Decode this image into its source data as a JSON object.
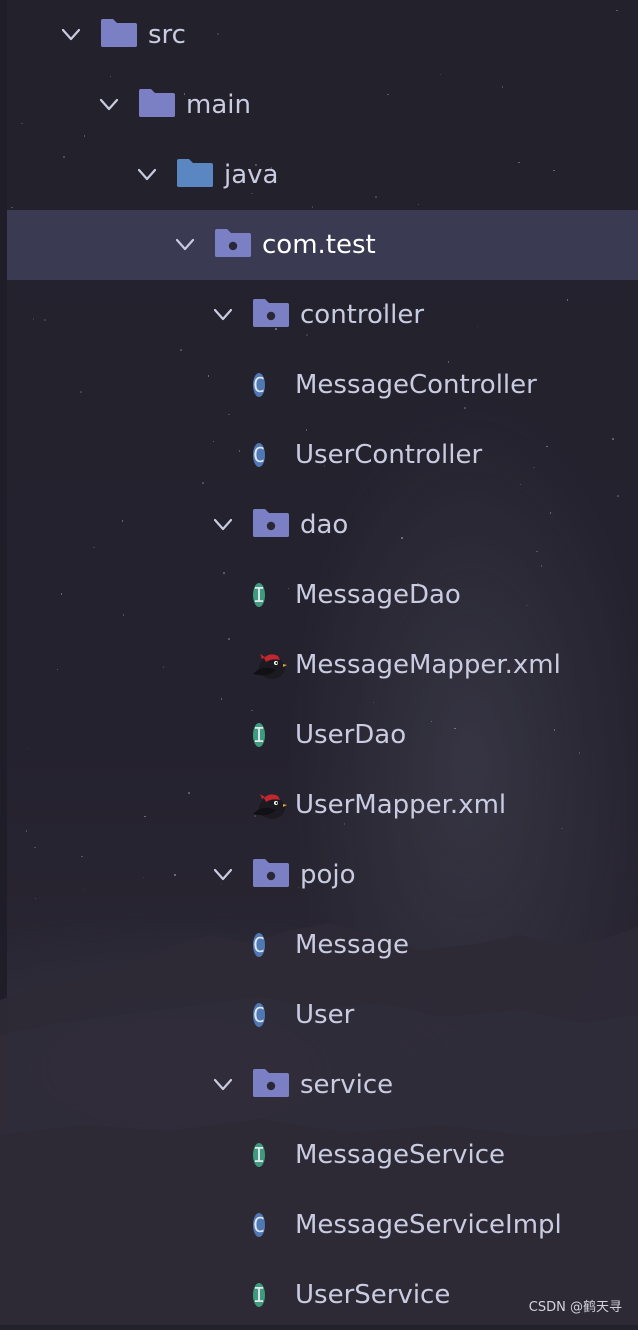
{
  "colors": {
    "background": "#24222e",
    "selection": "#3a3b52",
    "text": "#c9cbe0",
    "folder": "#7b80c4",
    "java_folder": "#5a86c2",
    "class_badge": "#4f78b4",
    "interface_badge": "#3f9b7d"
  },
  "tree": [
    {
      "label": "src",
      "type": "folder",
      "icon": "folder-icon",
      "expanded": true,
      "depth": 0
    },
    {
      "label": "main",
      "type": "folder",
      "icon": "folder-icon",
      "expanded": true,
      "depth": 1
    },
    {
      "label": "java",
      "type": "source-folder",
      "icon": "source-folder-icon",
      "expanded": true,
      "depth": 2
    },
    {
      "label": "com.test",
      "type": "package",
      "icon": "package-icon",
      "expanded": true,
      "depth": 3,
      "selected": true
    },
    {
      "label": "controller",
      "type": "package",
      "icon": "package-icon",
      "expanded": true,
      "depth": 4
    },
    {
      "label": "MessageController",
      "type": "class",
      "icon": "class-icon",
      "badge": "C",
      "depth": 5
    },
    {
      "label": "UserController",
      "type": "class",
      "icon": "class-icon",
      "badge": "C",
      "depth": 5
    },
    {
      "label": "dao",
      "type": "package",
      "icon": "package-icon",
      "expanded": true,
      "depth": 4
    },
    {
      "label": "MessageDao",
      "type": "interface",
      "icon": "interface-icon",
      "badge": "I",
      "depth": 5
    },
    {
      "label": "MessageMapper.xml",
      "type": "mybatis-xml",
      "icon": "mybatis-bird-icon",
      "depth": 5
    },
    {
      "label": "UserDao",
      "type": "interface",
      "icon": "interface-icon",
      "badge": "I",
      "depth": 5
    },
    {
      "label": "UserMapper.xml",
      "type": "mybatis-xml",
      "icon": "mybatis-bird-icon",
      "depth": 5
    },
    {
      "label": "pojo",
      "type": "package",
      "icon": "package-icon",
      "expanded": true,
      "depth": 4
    },
    {
      "label": "Message",
      "type": "class",
      "icon": "class-icon",
      "badge": "C",
      "depth": 5
    },
    {
      "label": "User",
      "type": "class",
      "icon": "class-icon",
      "badge": "C",
      "depth": 5
    },
    {
      "label": "service",
      "type": "package",
      "icon": "package-icon",
      "expanded": true,
      "depth": 4
    },
    {
      "label": "MessageService",
      "type": "interface",
      "icon": "interface-icon",
      "badge": "I",
      "depth": 5
    },
    {
      "label": "MessageServiceImpl",
      "type": "class",
      "icon": "class-icon",
      "badge": "C",
      "depth": 5
    },
    {
      "label": "UserService",
      "type": "interface",
      "icon": "interface-icon",
      "badge": "I",
      "depth": 5
    }
  ],
  "watermark": "CSDN @鹤天寻"
}
